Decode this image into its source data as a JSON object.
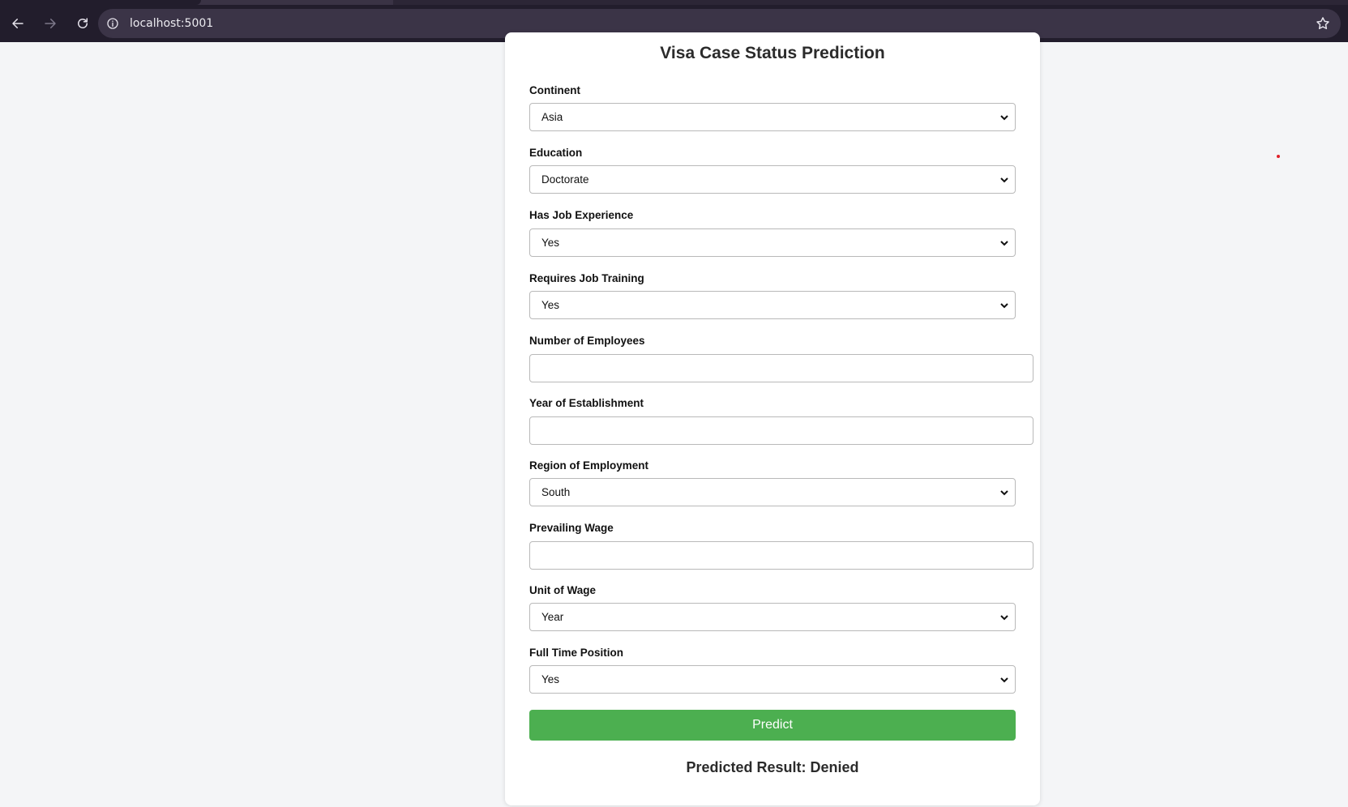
{
  "browser": {
    "url": "localhost:5001"
  },
  "form": {
    "title": "Visa Case Status Prediction",
    "fields": [
      {
        "label": "Continent",
        "type": "select",
        "value": "Asia"
      },
      {
        "label": "Education",
        "type": "select",
        "value": "Doctorate"
      },
      {
        "label": "Has Job Experience",
        "type": "select",
        "value": "Yes"
      },
      {
        "label": "Requires Job Training",
        "type": "select",
        "value": "Yes"
      },
      {
        "label": "Number of Employees",
        "type": "input",
        "value": ""
      },
      {
        "label": "Year of Establishment",
        "type": "input",
        "value": ""
      },
      {
        "label": "Region of Employment",
        "type": "select",
        "value": "South"
      },
      {
        "label": "Prevailing Wage",
        "type": "input",
        "value": ""
      },
      {
        "label": "Unit of Wage",
        "type": "select",
        "value": "Year"
      },
      {
        "label": "Full Time Position",
        "type": "select",
        "value": "Yes"
      }
    ],
    "submit_label": "Predict",
    "result_text": "Predicted Result: Denied"
  },
  "colors": {
    "accent": "#4caf50",
    "browser_toolbar": "#221d2c",
    "omnibox": "#3b3447"
  }
}
